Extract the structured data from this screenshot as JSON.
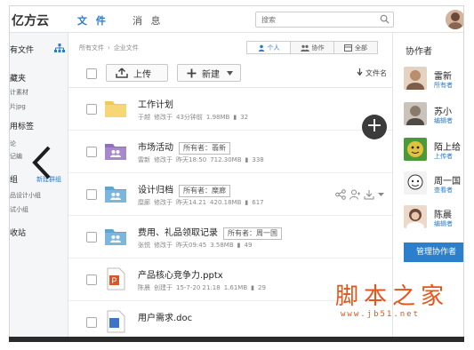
{
  "app": {
    "brand": "亿方云"
  },
  "topnav": {
    "file": "文 件",
    "message": "消 息"
  },
  "search": {
    "placeholder": "搜索"
  },
  "sidebar": {
    "items": [
      {
        "label": "有文件",
        "style": "h"
      },
      {
        "label": "藏夹",
        "style": "h"
      },
      {
        "label": "计素材",
        "style": "small"
      },
      {
        "label": "片jpg",
        "style": "small"
      },
      {
        "label": "用标签",
        "style": "h"
      },
      {
        "label": "论",
        "style": "small"
      },
      {
        "label": "记编",
        "style": "small"
      },
      {
        "label": "组",
        "style": "h"
      },
      {
        "label": "新建群组",
        "style": "blue"
      },
      {
        "label": "品设计小组",
        "style": "small"
      },
      {
        "label": "试小组",
        "style": "small"
      },
      {
        "label": "收站",
        "style": "h"
      }
    ]
  },
  "breadcrumb": {
    "root": "所有文件",
    "current": "企业文件"
  },
  "viewtabs": [
    {
      "label": "个人",
      "active": true
    },
    {
      "label": "协作",
      "active": false
    },
    {
      "label": "全部",
      "active": false
    }
  ],
  "toolbar": {
    "upload": "上传",
    "new": "新建",
    "sort": "文件名"
  },
  "files": [
    {
      "name": "工作计划",
      "owner": "",
      "user": "于越",
      "action": "修改于",
      "time": "43分钟前",
      "size": "1.98MB",
      "count": "32",
      "icon": "folder-yellow"
    },
    {
      "name": "市场活动",
      "owner": "所有者：翡新",
      "user": "雷新",
      "action": "修改于",
      "time": "昨天18:50",
      "size": "712.30MB",
      "count": "338",
      "icon": "folder-purple"
    },
    {
      "name": "设计归档",
      "owner": "所有者：糜廊",
      "user": "糜廊",
      "action": "修改于",
      "time": "昨天14.21",
      "size": "420.18MB",
      "count": "617",
      "icon": "folder-blue"
    },
    {
      "name": "费用、礼品领取记录",
      "owner": "所有者：周一国",
      "user": "张悦",
      "action": "修改于",
      "time": "昨天09:45",
      "size": "3.58MB",
      "count": "49",
      "icon": "folder-blue"
    },
    {
      "name": "产品核心竞争力.pptx",
      "owner": "",
      "user": "陈晨",
      "action": "创建于",
      "time": "15-7-20 21:18",
      "size": "1.61MB",
      "count": "29",
      "icon": "ppt"
    },
    {
      "name": "用户需求.doc",
      "owner": "",
      "user": "",
      "action": "",
      "time": "",
      "size": "",
      "count": "",
      "icon": "doc"
    }
  ],
  "collab_panel": {
    "title": "协作者",
    "members": [
      {
        "name": "雷新",
        "role": "所有者",
        "avatar_color": "#b98d6d"
      },
      {
        "name": "苏小",
        "role": "编辑者",
        "avatar_color": "#8a7a6a"
      },
      {
        "name": "陌上给",
        "role": "上传者",
        "avatar_color": "#e1c23a"
      },
      {
        "name": "周一国",
        "role": "查看者",
        "avatar_color": "#d9d9d9"
      },
      {
        "name": "陈晨",
        "role": "编辑者",
        "avatar_color": "#6b4a3a"
      }
    ],
    "manage": "管理协作者"
  },
  "watermark": {
    "text": "脚本之家",
    "url": "www.jb51.net"
  },
  "colors": {
    "accent": "#2a7bc9",
    "button": "#2c7fcb",
    "watermark": "#e8541a"
  }
}
